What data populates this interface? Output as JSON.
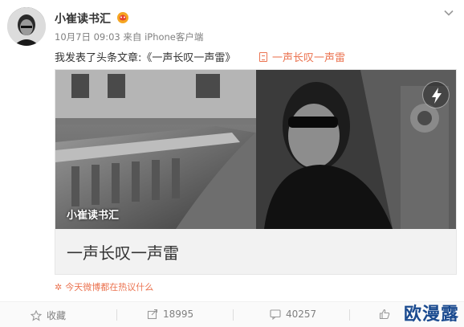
{
  "user": {
    "name": "小崔读书汇",
    "time": "10月7日 09:03",
    "source_prefix": "来自",
    "source": "iPhone客户端"
  },
  "post": {
    "text": "我发表了头条文章:《一声长叹一声雷》",
    "link_label": "一声长叹一声雷"
  },
  "card": {
    "image_caption": "小崔读书汇",
    "title": "一声长叹一声雷"
  },
  "trending": {
    "label": "今天微博都在热议什么"
  },
  "actions": {
    "favorite_label": "收藏",
    "share_count": "18995",
    "comment_count": "40257",
    "like_count": ""
  },
  "watermark": {
    "text": "欧漫露"
  },
  "colors": {
    "accent": "#eb7350",
    "text": "#333333",
    "muted": "#808080",
    "watermark": "#1a4a8f"
  }
}
